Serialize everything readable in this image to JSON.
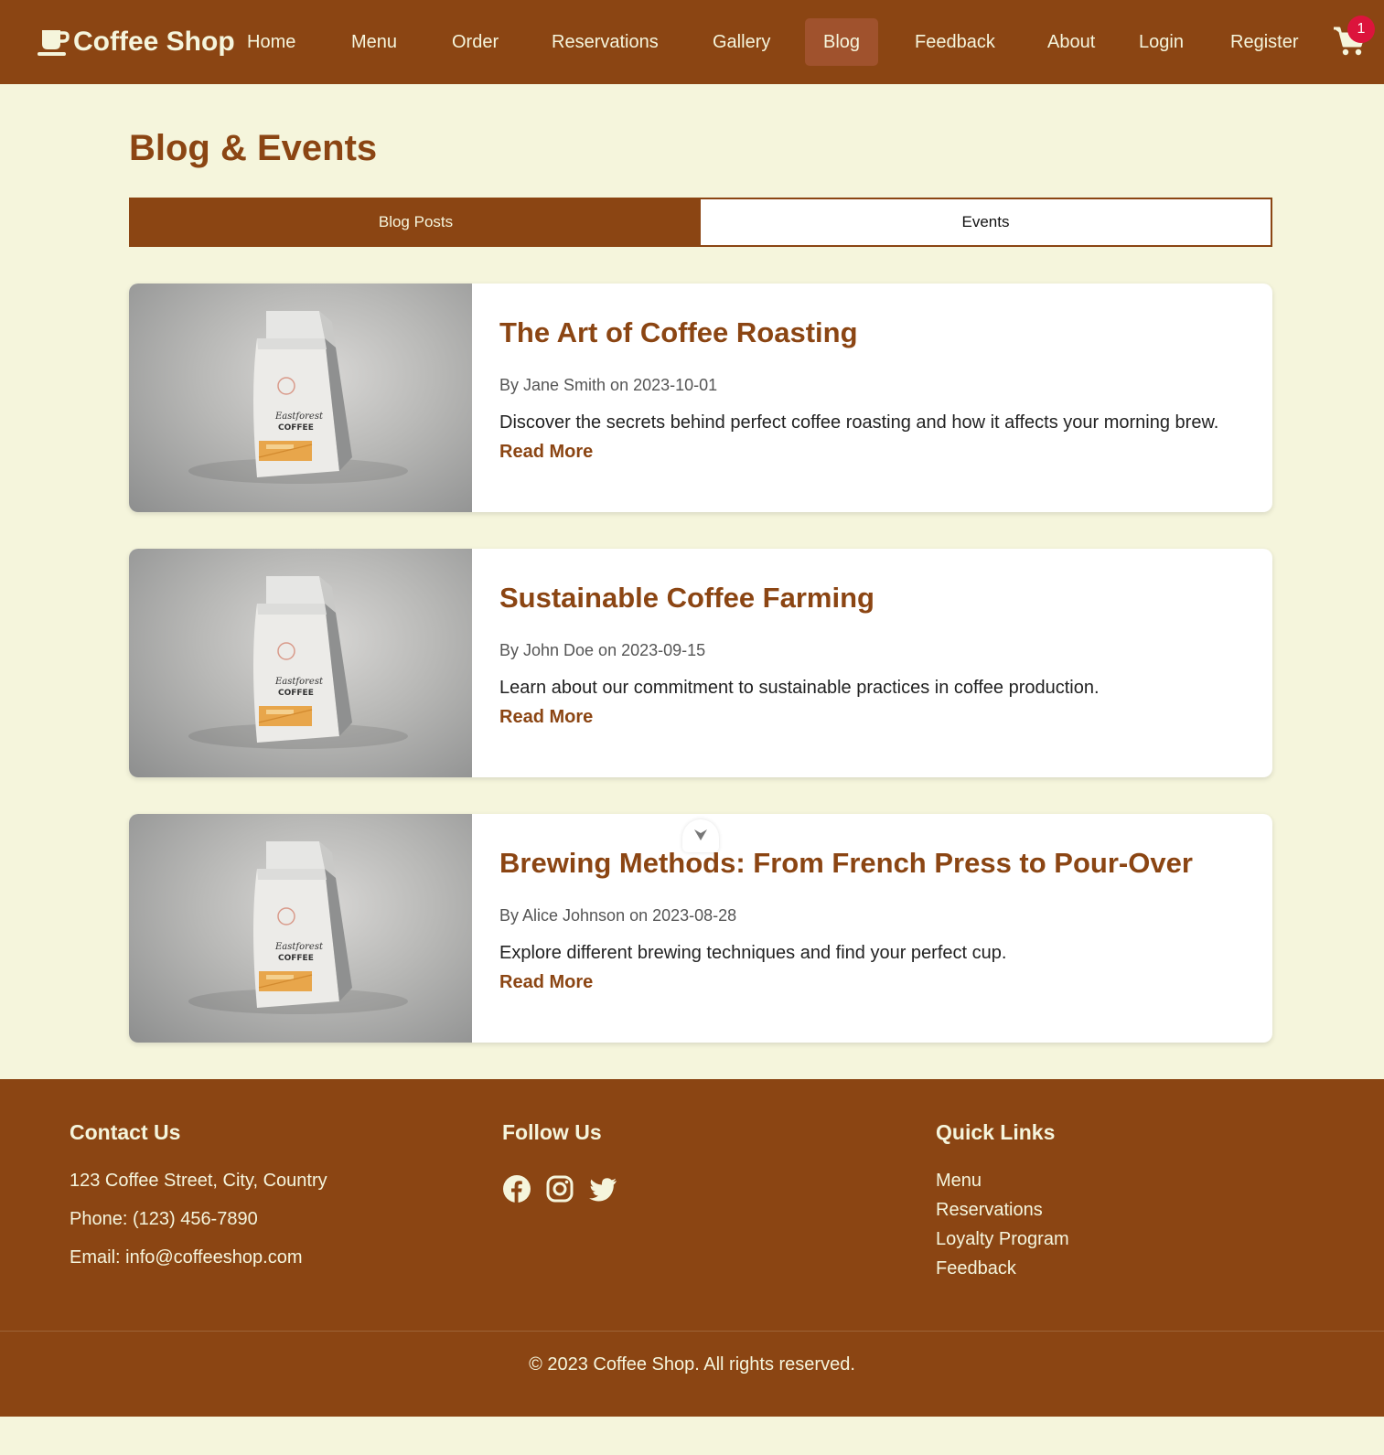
{
  "nav": {
    "brand": "Coffee Shop",
    "brand_icon": "coffee-cup-icon",
    "links": [
      "Home",
      "Menu",
      "Order",
      "Reservations",
      "Gallery",
      "Blog",
      "Feedback",
      "About",
      "Login",
      "Register"
    ],
    "active": "Blog",
    "cart_icon": "shopping-cart-icon",
    "cart_count": "1"
  },
  "page": {
    "title": "Blog & Events",
    "tabs": [
      "Blog Posts",
      "Events"
    ],
    "active_tab": "Blog Posts"
  },
  "posts": [
    {
      "title": "The Art of Coffee Roasting",
      "meta": "By Jane Smith on 2023-10-01",
      "excerpt": "Discover the secrets behind perfect coffee roasting and how it affects your morning brew.",
      "link": "Read More"
    },
    {
      "title": "Sustainable Coffee Farming",
      "meta": "By John Doe on 2023-09-15",
      "excerpt": "Learn about our commitment to sustainable practices in coffee production.",
      "link": "Read More"
    },
    {
      "title": "Brewing Methods: From French Press to Pour-Over",
      "meta": "By Alice Johnson on 2023-08-28",
      "excerpt": "Explore different brewing techniques and find your perfect cup.",
      "link": "Read More"
    }
  ],
  "product_image": {
    "label_line1": "Eastforest",
    "label_line2": "COFFEE"
  },
  "footer": {
    "contact": {
      "heading": "Contact Us",
      "address": "123 Coffee Street, City, Country",
      "phone": "Phone: (123) 456-7890",
      "email": "Email: info@coffeeshop.com"
    },
    "follow": {
      "heading": "Follow Us",
      "icons": [
        "facebook-icon",
        "instagram-icon",
        "twitter-icon"
      ]
    },
    "quick_links": {
      "heading": "Quick Links",
      "items": [
        "Menu",
        "Reservations",
        "Loyalty Program",
        "Feedback"
      ]
    },
    "copyright": "© 2023 Coffee Shop. All rights reserved."
  },
  "colors": {
    "brand": "#8b4513",
    "active_nav": "#a0522d",
    "background": "#f5f5dc",
    "badge": "#dc143c"
  }
}
